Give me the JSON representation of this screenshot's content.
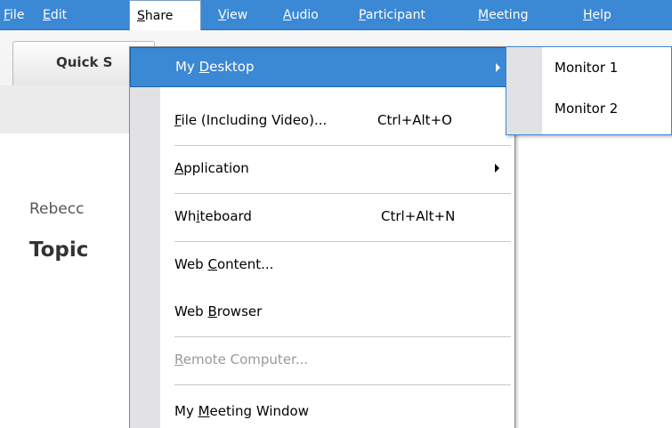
{
  "menubar": {
    "items": [
      {
        "pre": "",
        "key": "F",
        "post": "ile"
      },
      {
        "pre": "",
        "key": "E",
        "post": "dit"
      },
      {
        "pre": "",
        "key": "S",
        "post": "hare"
      },
      {
        "pre": "",
        "key": "V",
        "post": "iew"
      },
      {
        "pre": "",
        "key": "A",
        "post": "udio"
      },
      {
        "pre": "",
        "key": "P",
        "post": "articipant"
      },
      {
        "pre": "",
        "key": "M",
        "post": "eeting"
      },
      {
        "pre": "",
        "key": "H",
        "post": "elp"
      }
    ]
  },
  "background": {
    "tab_label": "Quick S",
    "name_text": "Rebecc",
    "topic_text": "Topic"
  },
  "share_menu": {
    "items": [
      {
        "pre": "My ",
        "key": "D",
        "post": "esktop",
        "shortcut": "",
        "submenu": true,
        "state": "highlighted"
      },
      {
        "pre": "",
        "key": "F",
        "post": "ile (Including Video)...",
        "shortcut": "Ctrl+Alt+O",
        "submenu": false,
        "state": "normal"
      },
      {
        "pre": "",
        "key": "A",
        "post": "pplication",
        "shortcut": "",
        "submenu": true,
        "state": "normal"
      },
      {
        "pre": "Wh",
        "key": "i",
        "post": "teboard",
        "shortcut": "Ctrl+Alt+N",
        "submenu": false,
        "state": "normal"
      },
      {
        "pre": "Web ",
        "key": "C",
        "post": "ontent...",
        "shortcut": "",
        "submenu": false,
        "state": "normal"
      },
      {
        "pre": "Web ",
        "key": "B",
        "post": "rowser",
        "shortcut": "",
        "submenu": false,
        "state": "normal"
      },
      {
        "pre": "",
        "key": "R",
        "post": "emote Computer...",
        "shortcut": "",
        "submenu": false,
        "state": "disabled"
      },
      {
        "pre": "My ",
        "key": "M",
        "post": "eeting Window",
        "shortcut": "",
        "submenu": false,
        "state": "normal"
      }
    ]
  },
  "desktop_submenu": {
    "items": [
      {
        "label": "Monitor 1"
      },
      {
        "label": "Monitor 2"
      }
    ]
  },
  "colors": {
    "accent": "#3b88d4",
    "disabled_text": "#9a9a9a",
    "gutter": "#e2e2e4"
  }
}
